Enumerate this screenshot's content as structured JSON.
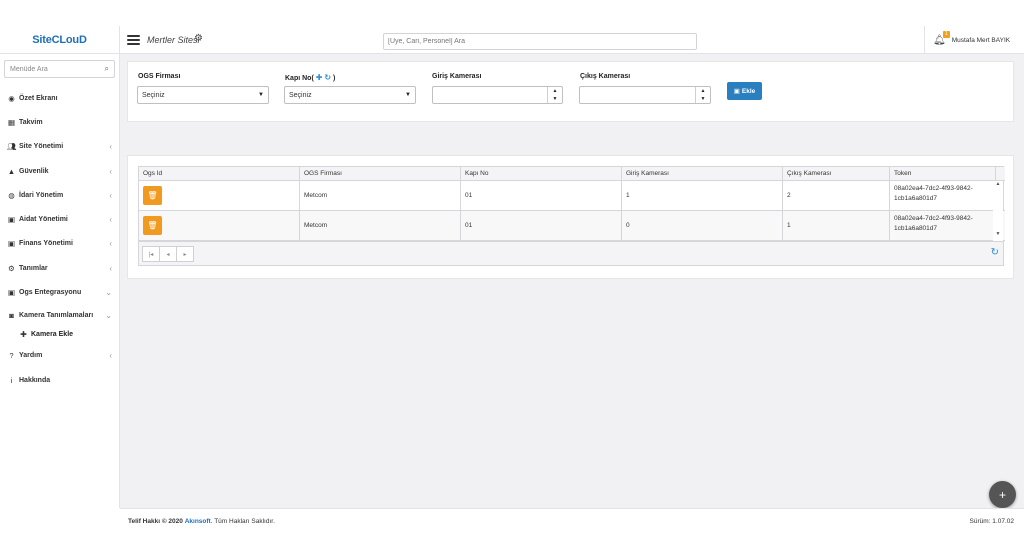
{
  "header": {
    "logo": "SiteCLouD",
    "site_title": "Mertler Sitesi",
    "search_placeholder": "[Üye, Cari, Personel] Ara",
    "notification_count": "1",
    "user_name": "Mustafa Mert BAYIK"
  },
  "sidebar": {
    "search_placeholder": "Menüde Ara",
    "items": [
      {
        "label": "Özet Ekranı",
        "icon": "dashboard-icon"
      },
      {
        "label": "Takvim",
        "icon": "calendar-icon"
      },
      {
        "label": "Site Yönetimi",
        "icon": "users-icon"
      },
      {
        "label": "Güvenlik",
        "icon": "lock-icon"
      },
      {
        "label": "İdari Yönetim",
        "icon": "globe-icon"
      },
      {
        "label": "Aidat Yönetimi",
        "icon": "money-icon"
      },
      {
        "label": "Finans Yönetimi",
        "icon": "money-icon"
      },
      {
        "label": "Tanımlar",
        "icon": "gear-icon"
      },
      {
        "label": "Ogs Entegrasyonu",
        "icon": "money-icon"
      },
      {
        "label": "Kamera Tanımlamaları",
        "icon": "camera-icon"
      },
      {
        "label": "Kamera Ekle",
        "icon": "plus-icon"
      },
      {
        "label": "Yardım",
        "icon": "question-icon"
      },
      {
        "label": "Hakkında",
        "icon": "info-icon"
      }
    ]
  },
  "form": {
    "ogs_label": "OGS Firması",
    "ogs_value": "Seçiniz",
    "kapi_label": "Kapı No(",
    "kapi_close": ")",
    "kapi_value": "Seçiniz",
    "giris_label": "Giriş Kamerası",
    "cikis_label": "Çıkış Kamerası",
    "add_label": "Ekle"
  },
  "grid": {
    "columns": [
      "Ogs Id",
      "OGS Firması",
      "Kapı No",
      "Giriş Kamerası",
      "Çıkış Kamerası",
      "Token"
    ],
    "rows": [
      {
        "firma": "Metcom",
        "kapi": "01",
        "giris": "1",
        "cikis": "2",
        "token1": "08a02ea4-7dc2-4f93-9842-",
        "token2": "1cb1a6a801d7"
      },
      {
        "firma": "Metcom",
        "kapi": "01",
        "giris": "0",
        "cikis": "1",
        "token1": "08a02ea4-7dc2-4f93-9842-",
        "token2": "1cb1a6a801d7"
      }
    ]
  },
  "footer": {
    "copyright_prefix": "Telif Hakkı © 2020",
    "brand": "Akınsoft",
    "copyright_suffix": ". Tüm Hakları Saklıdır.",
    "version": "Sürüm: 1.07.02"
  },
  "colors": {
    "accent": "#2a7fc1",
    "delete_button": "#f19a1f",
    "brand": "#1d6fb8"
  }
}
